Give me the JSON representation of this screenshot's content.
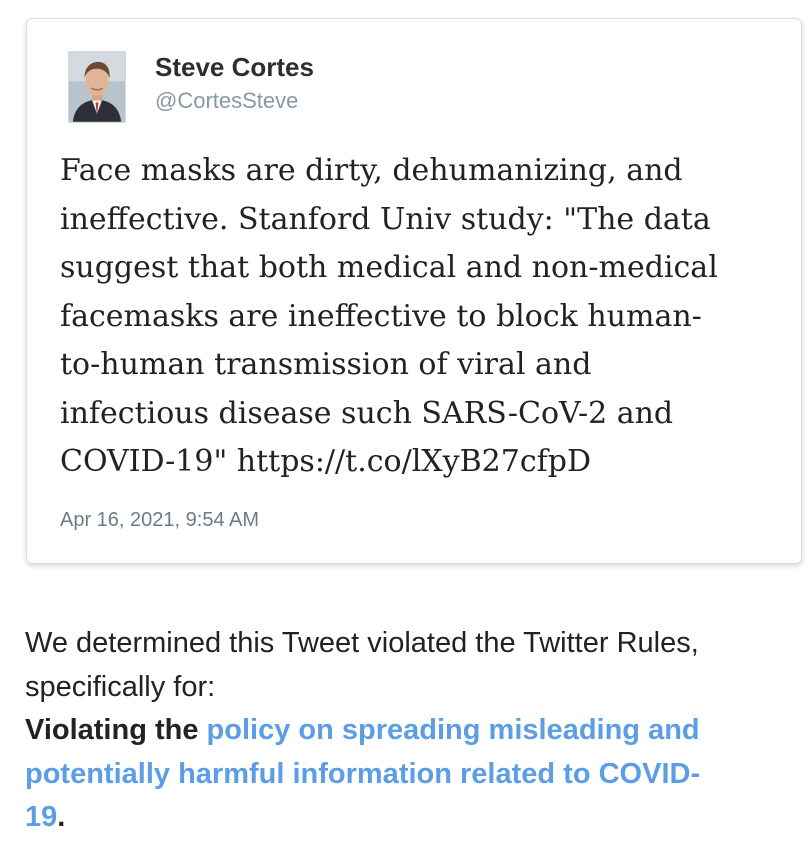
{
  "tweet": {
    "author_name": "Steve Cortes",
    "author_handle": "@CortesSteve",
    "avatar_icon": "person-avatar-icon",
    "text_lines": [
      "Face masks are dirty, dehumanizing, and",
      "ineffective. Stanford Univ study: \"The data",
      "suggest that both medical and non-medical",
      "facemasks are ineffective to block human-",
      "to-human transmission of viral and",
      "infectious disease such SARS-CoV-2 and",
      "COVID-19\" https://t.co/lXyB27cfpD"
    ],
    "timestamp": "Apr 16, 2021, 9:54 AM"
  },
  "notice": {
    "line1": "We determined this Tweet violated the Twitter Rules,",
    "line2": "specifically for:",
    "violation_prefix": "Violating the",
    "policy_link_part1": "policy on spreading misleading and",
    "policy_link_part2": "potentially harmful information related to COVID-",
    "policy_link_part3": "19",
    "period": "."
  },
  "colors": {
    "link": "#5b9ee5",
    "handle": "#8899a6",
    "timestamp": "#6e7b86",
    "card_border": "#dcdcdc"
  }
}
